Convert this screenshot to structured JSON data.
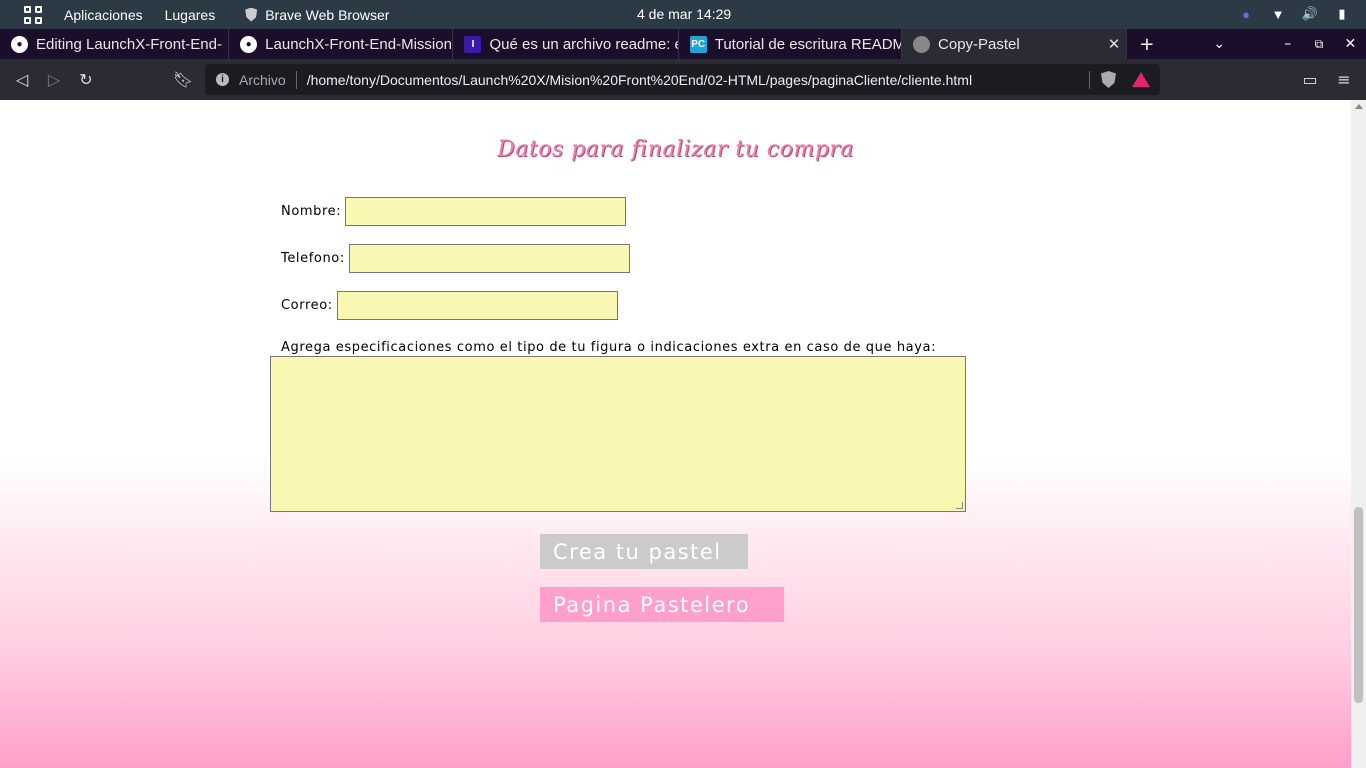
{
  "topbar": {
    "apps_label": "Aplicaciones",
    "places_label": "Lugares",
    "app_name": "Brave Web Browser",
    "clock": "4 de mar  14:29"
  },
  "tabs": [
    {
      "title": "Editing LaunchX-Front-End-",
      "favicon": "github-icon",
      "favicon_color": "#ffffff"
    },
    {
      "title": "LaunchX-Front-End-Mission",
      "favicon": "github-icon",
      "favicon_color": "#ffffff"
    },
    {
      "title": "Qué es un archivo readme: ex",
      "favicon": "indeed-icon",
      "favicon_color": "#3a1aa8"
    },
    {
      "title": "Tutorial de escritura README",
      "favicon": "pycharm-icon",
      "favicon_color": "#21a5d8"
    },
    {
      "title": "Copy-Pastel",
      "favicon": "globe-icon",
      "favicon_color": "#888888"
    }
  ],
  "address_bar": {
    "scheme": "Archivo",
    "url": "/home/tony/Documentos/Launch%20X/Mision%20Front%20End/02-HTML/pages/paginaCliente/cliente.html"
  },
  "form": {
    "title": "Datos para finalizar tu compra",
    "name_label": "Nombre:",
    "phone_label": "Telefono:",
    "email_label": "Correo:",
    "notes_label": "Agrega especificaciones como el tipo de tu figura o indicaciones extra en caso de que haya:",
    "create_button": "Crea tu pastel",
    "baker_button": "Pagina Pastelero"
  },
  "colors": {
    "input_bg": "#f8f8b2",
    "title_pink": "#ee7fae",
    "button_pink": "#ff9fcb",
    "button_gray": "#cbcbcb"
  }
}
